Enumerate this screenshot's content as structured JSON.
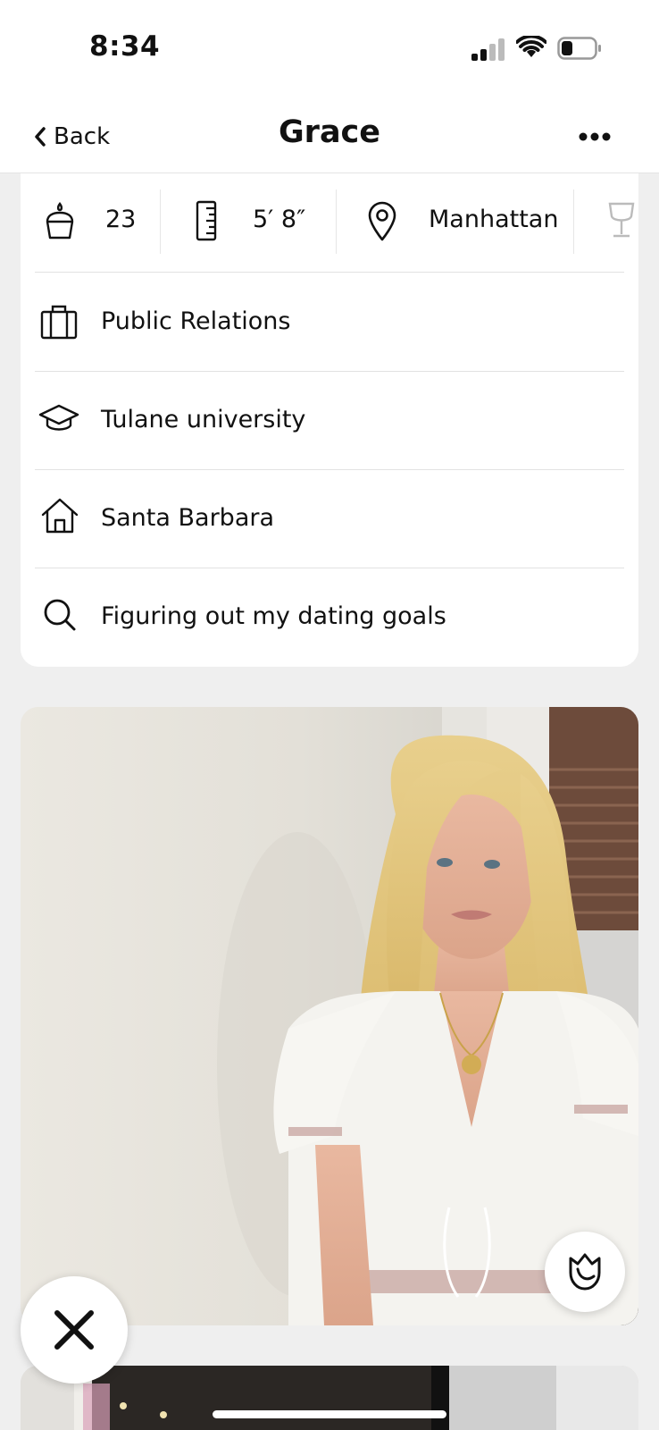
{
  "status_bar": {
    "time": "8:34"
  },
  "nav": {
    "back_label": "Back",
    "title": "Grace"
  },
  "vitals": {
    "age": "23",
    "height": "5′ 8″",
    "location": "Manhattan"
  },
  "info_rows": [
    {
      "icon": "briefcase-icon",
      "text": "Public Relations"
    },
    {
      "icon": "graduation-cap-icon",
      "text": "Tulane university"
    },
    {
      "icon": "house-icon",
      "text": "Santa Barbara"
    },
    {
      "icon": "search-icon",
      "text": "Figuring out my dating goals"
    }
  ],
  "colors": {
    "background": "#efefef",
    "card": "#ffffff",
    "text": "#111111"
  }
}
